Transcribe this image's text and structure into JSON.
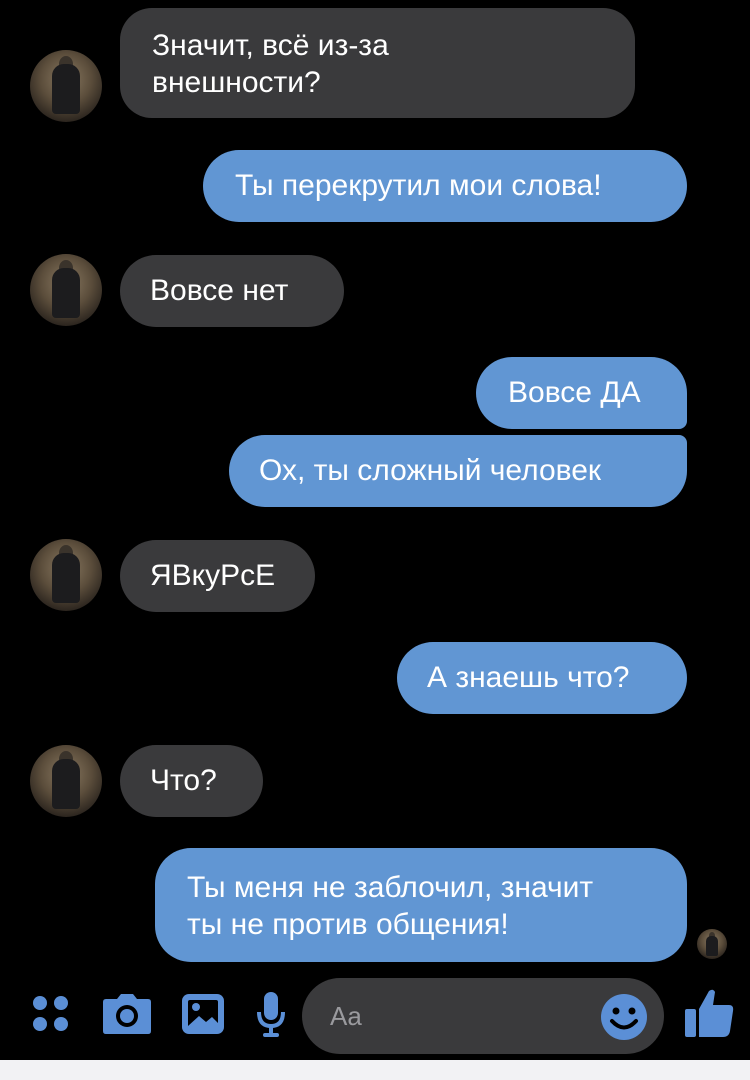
{
  "messages": [
    {
      "side": "in",
      "lines": [
        "Значит, всё из-за",
        "внешности?"
      ]
    },
    {
      "side": "out",
      "lines": [
        "Ты перекрутил мои слова!"
      ]
    },
    {
      "side": "in",
      "lines": [
        "Вовсе нет"
      ]
    },
    {
      "side": "out",
      "lines": [
        "Вовсе ДА"
      ]
    },
    {
      "side": "out",
      "lines": [
        "Ох, ты сложный человек"
      ]
    },
    {
      "side": "in",
      "lines": [
        "ЯВкуРсЕ"
      ]
    },
    {
      "side": "out",
      "lines": [
        "А знаешь что?"
      ]
    },
    {
      "side": "in",
      "lines": [
        "Что?"
      ]
    },
    {
      "side": "out",
      "lines": [
        "Ты меня не заблочил, значит",
        "ты не против общения!"
      ]
    }
  ],
  "composer": {
    "placeholder": "Aa",
    "accent_color": "#5b8fd6",
    "icons": [
      "menu-dots-icon",
      "camera-icon",
      "image-icon",
      "microphone-icon",
      "emoji-icon",
      "thumbs-up-icon"
    ]
  }
}
